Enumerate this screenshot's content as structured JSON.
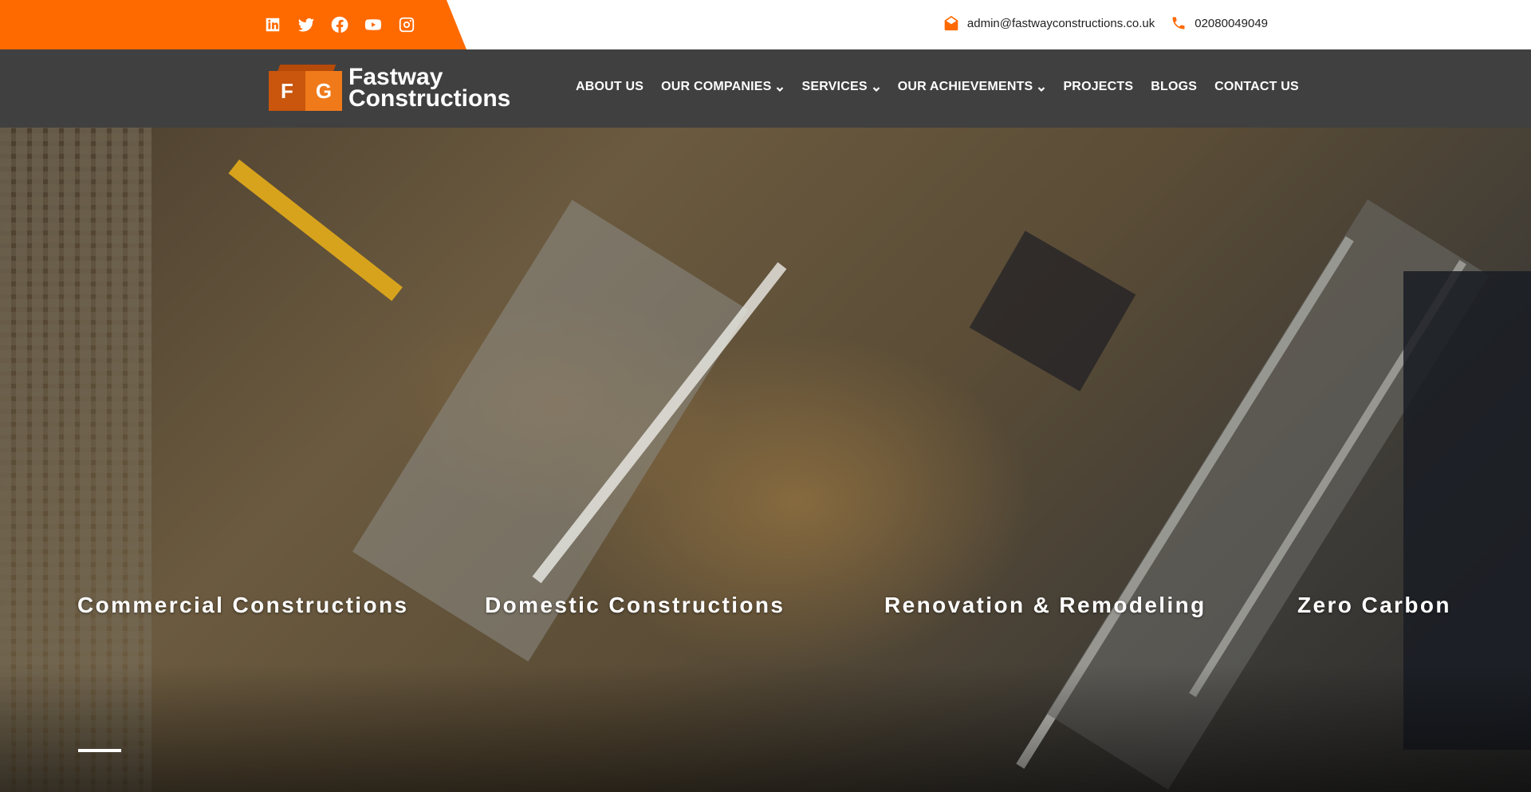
{
  "topbar": {
    "social_icons": [
      "linkedin-icon",
      "twitter-icon",
      "facebook-icon",
      "youtube-icon",
      "instagram-icon"
    ],
    "email": "admin@fastwayconstructions.co.uk",
    "phone": "02080049049",
    "accent_color": "#ff6a00"
  },
  "header": {
    "logo": {
      "mark_f": "F",
      "mark_g": "G",
      "line1": "Fastway",
      "line2": "Constructions"
    },
    "nav": [
      {
        "label": "ABOUT US",
        "dropdown": false
      },
      {
        "label": "OUR COMPANIES",
        "dropdown": true
      },
      {
        "label": "SERVICES",
        "dropdown": true
      },
      {
        "label": "OUR ACHIEVEMENTS",
        "dropdown": true
      },
      {
        "label": "PROJECTS",
        "dropdown": false
      },
      {
        "label": "BLOGS",
        "dropdown": false
      },
      {
        "label": "CONTACT US",
        "dropdown": false
      }
    ]
  },
  "hero": {
    "slides": [
      {
        "label": "Commercial Constructions",
        "active": true
      },
      {
        "label": "Domestic Constructions",
        "active": false
      },
      {
        "label": "Renovation & Remodeling",
        "active": false
      },
      {
        "label": "Zero Carbon",
        "active": false
      }
    ]
  }
}
